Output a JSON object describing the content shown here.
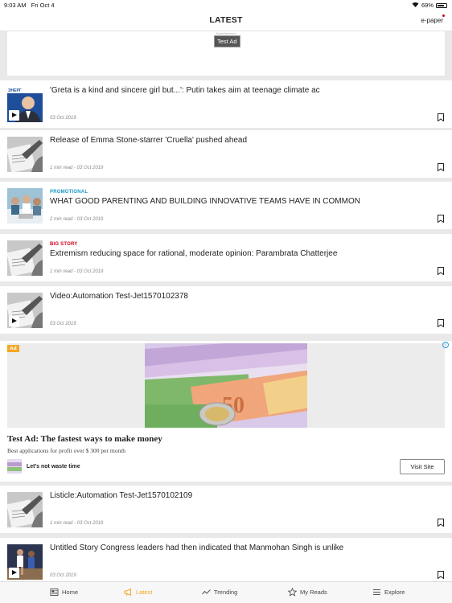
{
  "status_bar": {
    "time": "9:03 AM",
    "date": "Fri Oct 4",
    "battery": "69%"
  },
  "header": {
    "title": "LATEST",
    "epaper": "e-paper"
  },
  "banner_ad": {
    "small_text": "Advertisement",
    "label": "Test Ad"
  },
  "articles": [
    {
      "kicker": "",
      "title": "'Greta is a kind and sincere girl but...': Putin takes aim at teenage climate ac",
      "meta": "03 Oct 2019",
      "video": true,
      "thumb": "portrait"
    },
    {
      "kicker": "",
      "title": "Release of Emma Stone-starrer 'Cruella' pushed ahead",
      "meta": "1 min read - 03 Oct 2019",
      "video": false,
      "thumb": "writing"
    },
    {
      "kicker": "PROMOTIONAL",
      "kicker_color": "#1a9bc7",
      "title": "WHAT GOOD PARENTING AND BUILDING INNOVATIVE TEAMS HAVE IN COMMON",
      "meta": "2 min read - 03 Oct 2019",
      "video": false,
      "thumb": "team"
    },
    {
      "kicker": "BIG STORY",
      "kicker_color": "#d0021b",
      "title": "Extremism reducing space for rational, moderate opinion: Parambrata Chatterjee",
      "meta": "1 min read - 03 Oct 2019",
      "video": false,
      "thumb": "writing"
    },
    {
      "kicker": "",
      "title": "Video:Automation Test-Jet1570102378",
      "meta": "03 Oct 2019",
      "video": true,
      "thumb": "writing"
    },
    {
      "kicker": "",
      "title": "Listicle:Automation Test-Jet1570102109",
      "meta": "1 min read - 03 Oct 2019",
      "video": false,
      "thumb": "writing"
    },
    {
      "kicker": "",
      "title": "Untitled Story Congress leaders had then indicated that Manmohan Singh is unlike",
      "meta": "03 Oct 2019",
      "video": true,
      "thumb": "sports"
    }
  ],
  "promo_ad": {
    "badge": "Ad",
    "info": "i",
    "headline": "Test Ad: The fastest ways to make money",
    "subtext": "Best applications for profit over $ 300 per month",
    "brand": "Let's not waste time",
    "cta": "Visit Site"
  },
  "tabs": [
    {
      "label": "Home",
      "icon": "home-icon",
      "active": false
    },
    {
      "label": "Latest",
      "icon": "megaphone-icon",
      "active": true
    },
    {
      "label": "Trending",
      "icon": "trending-icon",
      "active": false
    },
    {
      "label": "My Reads",
      "icon": "star-icon",
      "active": false
    },
    {
      "label": "Explore",
      "icon": "menu-icon",
      "active": false
    }
  ],
  "colors": {
    "accent": "#f5a623",
    "promotional": "#1a9bc7",
    "big_story": "#d0021b"
  }
}
